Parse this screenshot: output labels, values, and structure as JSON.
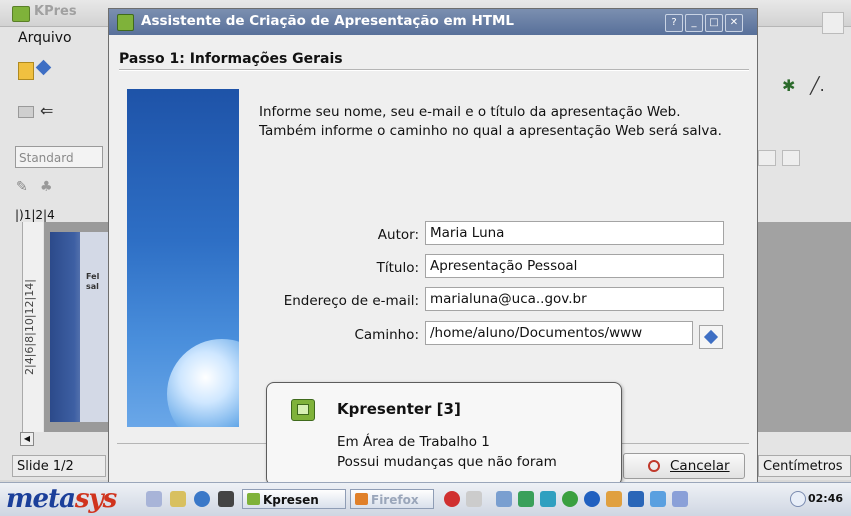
{
  "background_app": {
    "title": "KPres",
    "menu_first": "Arquivo",
    "style_combo": "Standard",
    "ruler_numbers": "|)1|2|4",
    "vertical_ruler": "2|4|6|8|10|12|14|",
    "slide_text": "Fel sal",
    "status_left": "Slide 1/2",
    "status_right": "Centímetros"
  },
  "dialog": {
    "title": "Assistente de Criação de Apresentação em HTML",
    "step_title": "Passo 1: Informações Gerais",
    "intro_text": "Informe seu nome, seu e-mail e o título da apresentação Web. Também informe o caminho no qual a apresentação Web será salva.",
    "fields": {
      "author_label": "Autor:",
      "author_value": "Maria Luna",
      "title_label": "Título:",
      "title_value": "Apresentação Pessoal",
      "email_label": "Endereço de e-mail:",
      "email_value": "marialuna@uca..gov.br",
      "path_label": "Caminho:",
      "path_value": "/home/aluno/Documentos/www"
    },
    "buttons": {
      "help": "?",
      "minimize": "_",
      "maximize": "□",
      "close": "✕",
      "cancel": "Cancelar"
    }
  },
  "notification": {
    "title": "Kpresenter [3]",
    "line1": "Em Área de Trabalho 1",
    "line2": "Possui mudanças que não foram"
  },
  "taskbar": {
    "logo_meta": "meta",
    "logo_sys": "sys",
    "task_kpresenter": "Kpresen",
    "task_firefox": "Firefox",
    "clock": "02:46"
  }
}
